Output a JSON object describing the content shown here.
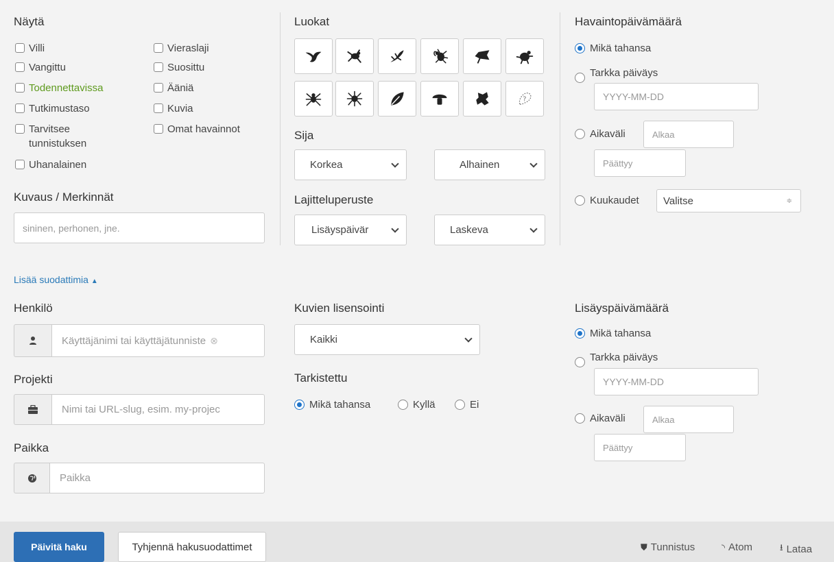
{
  "show": {
    "heading": "Näytä",
    "left": [
      "Villi",
      "Vangittu",
      "Todennettavissa",
      "Tutkimustaso",
      "Tarvitsee",
      "Uhanalainen"
    ],
    "left_wrap": "tunnistuksen",
    "right": [
      "Vieraslaji",
      "Suosittu",
      "Ääniä",
      "Kuvia",
      "Omat havainnot"
    ]
  },
  "description": {
    "heading": "Kuvaus / Merkinnät",
    "placeholder": "sininen, perhonen, jne."
  },
  "classes": {
    "heading": "Luokat"
  },
  "rank": {
    "heading": "Sija",
    "high": "Korkea",
    "low": "Alhainen"
  },
  "sort": {
    "heading": "Lajitteluperuste",
    "by": "Lisäyspäivär",
    "order": "Laskeva"
  },
  "observed": {
    "heading": "Havaintopäivämäärä",
    "any": "Mikä tahansa",
    "exact": "Tarkka päiväys",
    "date_placeholder": "YYYY-MM-DD",
    "range": "Aikaväli",
    "start": "Alkaa",
    "end": "Päättyy",
    "months": "Kuukaudet",
    "months_value": "Valitse"
  },
  "more_filters": "Lisää suodattimia",
  "person": {
    "heading": "Henkilö",
    "placeholder": "Käyttäjänimi tai käyttäjätunniste"
  },
  "project": {
    "heading": "Projekti",
    "placeholder": "Nimi tai URL-slug, esim. my-projec"
  },
  "place": {
    "heading": "Paikka",
    "placeholder": "Paikka"
  },
  "licensing": {
    "heading": "Kuvien lisensointi",
    "value": "Kaikki"
  },
  "reviewed": {
    "heading": "Tarkistettu",
    "any": "Mikä tahansa",
    "yes": "Kyllä",
    "no": "Ei"
  },
  "added": {
    "heading": "Lisäyspäivämäärä",
    "any": "Mikä tahansa",
    "exact": "Tarkka päiväys",
    "date_placeholder": "YYYY-MM-DD",
    "range": "Aikaväli",
    "start": "Alkaa",
    "end": "Päättyy"
  },
  "footer": {
    "update": "Päivitä haku",
    "clear": "Tyhjennä hakusuodattimet",
    "identify": "Tunnistus",
    "atom": "Atom",
    "download": "Lataa"
  },
  "colors": {
    "accent": "#2d6fb5",
    "link": "#2a7ab8",
    "green": "#5e9a1e",
    "background": "#f3f3f3"
  }
}
